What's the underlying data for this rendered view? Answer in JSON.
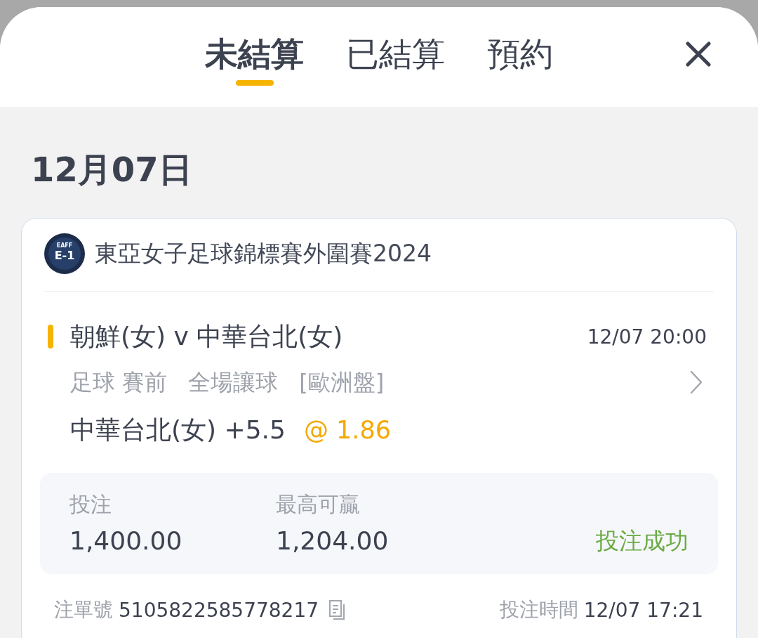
{
  "tabs": [
    {
      "label": "未結算",
      "selected": true
    },
    {
      "label": "已結算",
      "selected": false
    },
    {
      "label": "預約",
      "selected": false
    }
  ],
  "date_heading": "12月07日",
  "bet_card": {
    "league_logo": {
      "lines": [
        "EAFF",
        "E-1"
      ]
    },
    "league": "東亞女子足球錦標賽外圍賽2024",
    "match": "朝鮮(女) v 中華台北(女)",
    "kickoff": "12/07 20:00",
    "market": [
      "足球 賽前",
      "全場讓球",
      "[歐洲盤]"
    ],
    "selection": "中華台北(女) +5.5",
    "odds": "@ 1.86",
    "stake_label": "投注",
    "stake": "1,400.00",
    "max_win_label": "最高可贏",
    "max_win": "1,204.00",
    "status": {
      "label": "投注成功",
      "kind": "success"
    },
    "bet_id_label": "注單號",
    "bet_id": "5105822585778217",
    "bet_time_label": "投注時間",
    "bet_time": "12/07 17:21"
  }
}
